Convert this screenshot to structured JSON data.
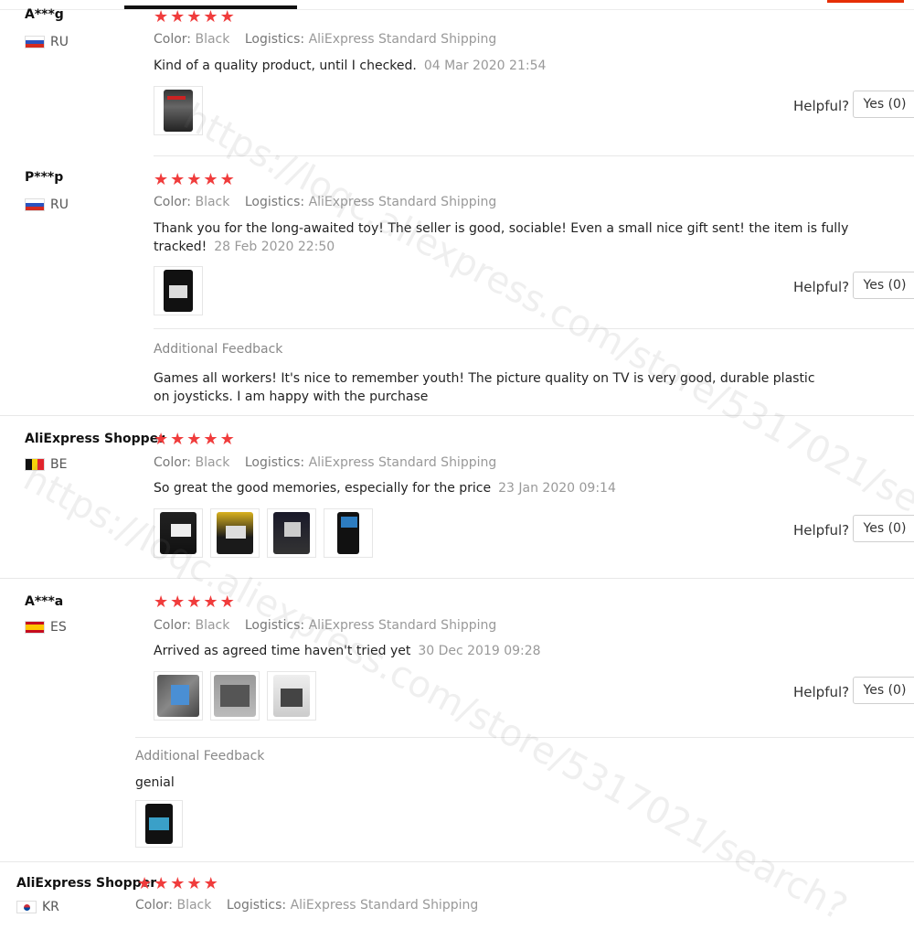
{
  "watermark": "https://loqc.aliexpress.com/store/5317021/search?",
  "labels": {
    "color": "Color:",
    "logistics": "Logistics:",
    "helpful": "Helpful?",
    "yes": "Yes (0)",
    "additional_feedback": "Additional Feedback"
  },
  "reviews": [
    {
      "user": "A***g",
      "country": "RU",
      "rating": 5,
      "color": "Black",
      "logistics": "AliExpress Standard Shipping",
      "text": "Kind of a quality product, until I checked.",
      "date": "04 Mar 2020 21:54"
    },
    {
      "user": "P***p",
      "country": "RU",
      "rating": 5,
      "color": "Black",
      "logistics": "AliExpress Standard Shipping",
      "text": "Thank you for the long-awaited toy! The seller is good, sociable! Even a small nice gift sent! the item is fully tracked!",
      "date": "28 Feb 2020 22:50",
      "additional": "Games all workers! It's nice to remember youth! The picture quality on TV is very good, durable plastic on joysticks. I am happy with the purchase"
    },
    {
      "user": "AliExpress Shopper",
      "country": "BE",
      "rating": 5,
      "color": "Black",
      "logistics": "AliExpress Standard Shipping",
      "text": "So great the good memories, especially for the price",
      "date": "23 Jan 2020 09:14"
    },
    {
      "user": "A***a",
      "country": "ES",
      "rating": 5,
      "color": "Black",
      "logistics": "AliExpress Standard Shipping",
      "text": "Arrived as agreed time haven't tried yet",
      "date": "30 Dec 2019 09:28",
      "additional": "genial"
    },
    {
      "user": "AliExpress Shopper",
      "country": "KR",
      "rating": 5,
      "color": "Black",
      "logistics": "AliExpress Standard Shipping"
    }
  ],
  "colors": {
    "star": "#f03c3c",
    "accent_red": "#e62e04"
  }
}
